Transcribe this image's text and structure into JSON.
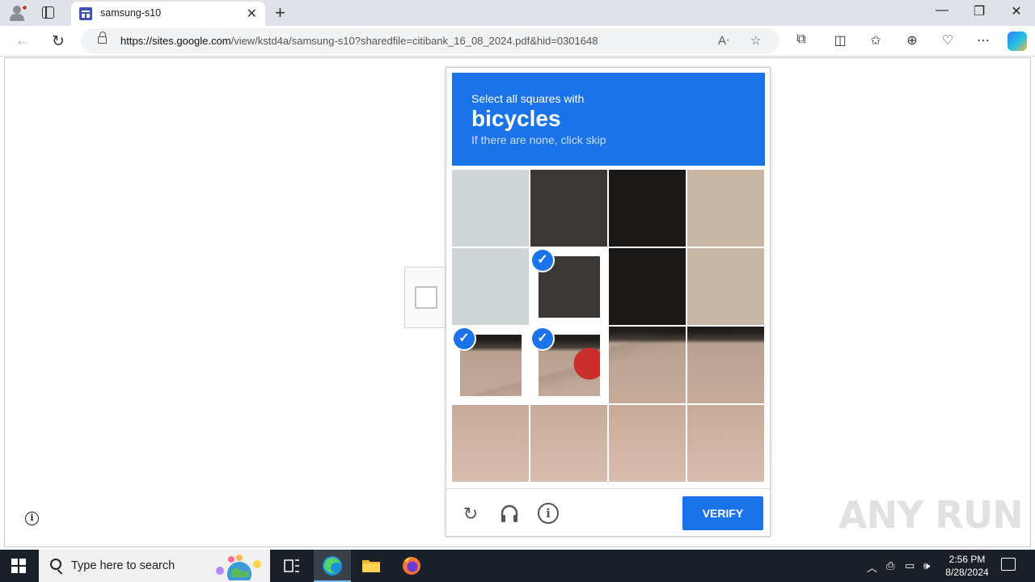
{
  "browser": {
    "tab_title": "samsung-s10",
    "url_host": "https://sites.google.com",
    "url_path": "/view/kstd4a/samsung-s10?sharedfile=citibank_16_08_2024.pdf&hid=0301648",
    "icons": [
      "profile-icon",
      "tabs-icon",
      "site-favicon",
      "close-icon",
      "new-tab-icon",
      "minimize-icon",
      "restore-icon",
      "window-close-icon",
      "back-icon",
      "refresh-icon",
      "lock-icon",
      "read-aloud-icon",
      "favorite-icon",
      "extensions-icon",
      "split-screen-icon",
      "favorites-icon",
      "collections-icon",
      "performance-icon",
      "more-icon",
      "copilot-icon"
    ]
  },
  "captcha": {
    "prompt_line1": "Select all squares with",
    "target": "bicycles",
    "prompt_line3": "If there are none, click skip",
    "selected_tiles": [
      5,
      8,
      9
    ],
    "verify_label": "VERIFY",
    "accent_color": "#1a73e8"
  },
  "watermark": "ANY RUN",
  "taskbar": {
    "search_placeholder": "Type here to search",
    "time": "2:56 PM",
    "date": "8/28/2024"
  }
}
